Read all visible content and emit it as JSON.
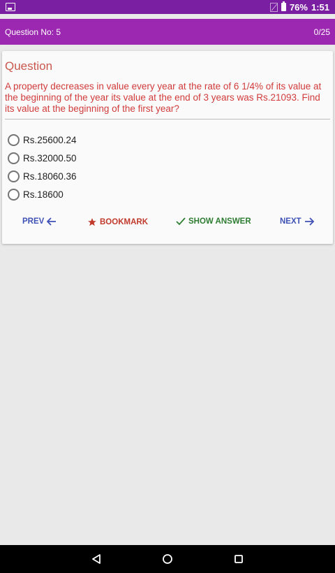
{
  "status_bar": {
    "battery": "76%",
    "time": "1:51"
  },
  "app_bar": {
    "question_label": "Question No: 5",
    "progress": "0/25"
  },
  "question": {
    "heading": "Question",
    "text": "A property decreases in value every year at the rate of 6 1/4% of its value at the beginning of the year its value at the end of 3 years was Rs.21093. Find its value at the beginning of the first year?",
    "options": [
      {
        "label": "Rs.25600.24"
      },
      {
        "label": "Rs.32000.50"
      },
      {
        "label": "Rs.18060.36"
      },
      {
        "label": "Rs.18600"
      }
    ]
  },
  "actions": {
    "prev": "PREV",
    "bookmark": "BOOKMARK",
    "show_answer": "SHOW ANSWER",
    "next": "NEXT"
  },
  "colors": {
    "status_bar": "#7b1fa2",
    "app_bar": "#9c27b0",
    "question_text": "#d23b3b",
    "prev_next": "#3f51b5",
    "bookmark": "#c0392b",
    "show_answer": "#2e7d32"
  },
  "icons": {
    "status_left": "image-icon",
    "sim": "no-sim-icon",
    "battery": "battery-icon",
    "prev": "arrow-left-icon",
    "bookmark": "star-icon",
    "show_answer": "check-icon",
    "next": "arrow-right-icon",
    "nav_back": "back-triangle-icon",
    "nav_home": "home-circle-icon",
    "nav_recent": "recent-square-icon"
  }
}
